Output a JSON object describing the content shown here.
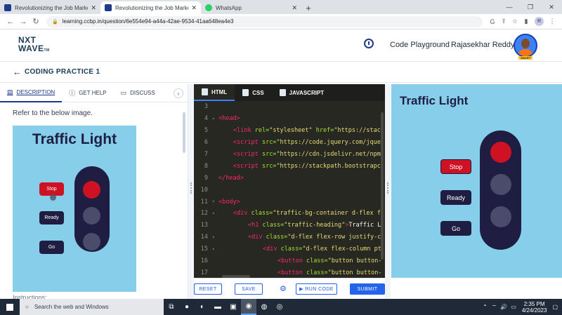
{
  "browser": {
    "tabs": [
      {
        "title": "Revolutionizing the Job Market |",
        "active": false
      },
      {
        "title": "Revolutionizing the Job Market |",
        "active": true
      },
      {
        "title": "WhatsApp",
        "active": false
      }
    ],
    "url": "learning.ccbp.in/question/6e554e94-a44a-42ae-9534-41aa648ea4e3",
    "profile_initial": "R"
  },
  "header": {
    "logo_line1": "NXT",
    "logo_line2": "WAVE",
    "logo_tm": "TM",
    "code_playground": "Code Playground",
    "username": "Rajasekhar Reddy",
    "avatar_badge": "SMART"
  },
  "subheader": {
    "title": "CODING PRACTICE 1"
  },
  "left_panel": {
    "tabs": [
      {
        "label": "DESCRIPTION",
        "icon": "book-icon"
      },
      {
        "label": "GET HELP",
        "icon": "help-icon"
      },
      {
        "label": "DISCUSS",
        "icon": "chat-icon"
      }
    ],
    "refer_text": "Refer to the below image.",
    "instructions_label": "Instructions:",
    "preview": {
      "title": "Traffic Light",
      "buttons": [
        "Stop",
        "Ready",
        "Go"
      ]
    }
  },
  "editor": {
    "tabs": [
      "HTML",
      "CSS",
      "JAVASCRIPT"
    ],
    "lines": [
      {
        "n": "3",
        "fold": "",
        "indent": 0,
        "parts": []
      },
      {
        "n": "4",
        "fold": "▾",
        "indent": 0,
        "parts": [
          {
            "c": "tag",
            "t": "<head>"
          }
        ]
      },
      {
        "n": "5",
        "fold": "",
        "indent": 1,
        "parts": [
          {
            "c": "tag",
            "t": "<link "
          },
          {
            "c": "attr",
            "t": "rel="
          },
          {
            "c": "str",
            "t": "\"stylesheet\" "
          },
          {
            "c": "attr",
            "t": "href="
          },
          {
            "c": "str",
            "t": "\"https://stac"
          }
        ]
      },
      {
        "n": "6",
        "fold": "",
        "indent": 1,
        "parts": [
          {
            "c": "tag",
            "t": "<script "
          },
          {
            "c": "attr",
            "t": "src="
          },
          {
            "c": "str",
            "t": "\"https://code.jquery.com/jque"
          }
        ]
      },
      {
        "n": "7",
        "fold": "",
        "indent": 1,
        "parts": [
          {
            "c": "tag",
            "t": "<script "
          },
          {
            "c": "attr",
            "t": "src="
          },
          {
            "c": "str",
            "t": "\"https://cdn.jsdelivr.net/npm"
          }
        ]
      },
      {
        "n": "8",
        "fold": "",
        "indent": 1,
        "parts": [
          {
            "c": "tag",
            "t": "<script "
          },
          {
            "c": "attr",
            "t": "src="
          },
          {
            "c": "str",
            "t": "\"https://stackpath.bootstrapc"
          }
        ]
      },
      {
        "n": "9",
        "fold": "",
        "indent": 0,
        "parts": [
          {
            "c": "tag",
            "t": "</head>"
          }
        ]
      },
      {
        "n": "10",
        "fold": "",
        "indent": 0,
        "parts": []
      },
      {
        "n": "11",
        "fold": "▾",
        "indent": 0,
        "parts": [
          {
            "c": "tag",
            "t": "<body>"
          }
        ]
      },
      {
        "n": "12",
        "fold": "▾",
        "indent": 1,
        "parts": [
          {
            "c": "tag",
            "t": "<div "
          },
          {
            "c": "attr",
            "t": "class="
          },
          {
            "c": "str",
            "t": "\"traffic-bg-container d-flex f"
          }
        ]
      },
      {
        "n": "13",
        "fold": "",
        "indent": 2,
        "parts": [
          {
            "c": "tag",
            "t": "<h1 "
          },
          {
            "c": "attr",
            "t": "class="
          },
          {
            "c": "str",
            "t": "\"traffic-heading\""
          },
          {
            "c": "tag",
            "t": ">"
          },
          {
            "c": "plain",
            "t": "Traffic L"
          }
        ]
      },
      {
        "n": "14",
        "fold": "▾",
        "indent": 2,
        "parts": [
          {
            "c": "tag",
            "t": "<div "
          },
          {
            "c": "attr",
            "t": "class="
          },
          {
            "c": "str",
            "t": "\"d-flex flex-row justify-c"
          }
        ]
      },
      {
        "n": "15",
        "fold": "▾",
        "indent": 3,
        "parts": [
          {
            "c": "tag",
            "t": "<div "
          },
          {
            "c": "attr",
            "t": "class="
          },
          {
            "c": "str",
            "t": "\"d-flex flex-column pt"
          }
        ]
      },
      {
        "n": "16",
        "fold": "",
        "indent": 4,
        "parts": [
          {
            "c": "tag",
            "t": "<button "
          },
          {
            "c": "attr",
            "t": "class="
          },
          {
            "c": "str",
            "t": "\"button button-"
          }
        ]
      },
      {
        "n": "17",
        "fold": "",
        "indent": 4,
        "parts": [
          {
            "c": "tag",
            "t": "<button "
          },
          {
            "c": "attr",
            "t": "class="
          },
          {
            "c": "str",
            "t": "\"button button-"
          }
        ]
      }
    ],
    "footer": {
      "reset": "RESET",
      "save": "SAVE",
      "run": "▶ RUN CODE",
      "submit": "SUBMIT"
    }
  },
  "output": {
    "title": "Traffic Light",
    "buttons": [
      "Stop",
      "Ready",
      "Go"
    ]
  },
  "taskbar": {
    "search_placeholder": "Search the web and Windows",
    "time": "2:35 PM",
    "date": "4/24/2023"
  },
  "colors": {
    "preview_bg": "#87ceeb",
    "light_body": "#1f1d41",
    "stop_red": "#cf1124",
    "lamp_off": "#4b4b6b",
    "primary": "#2563eb"
  }
}
